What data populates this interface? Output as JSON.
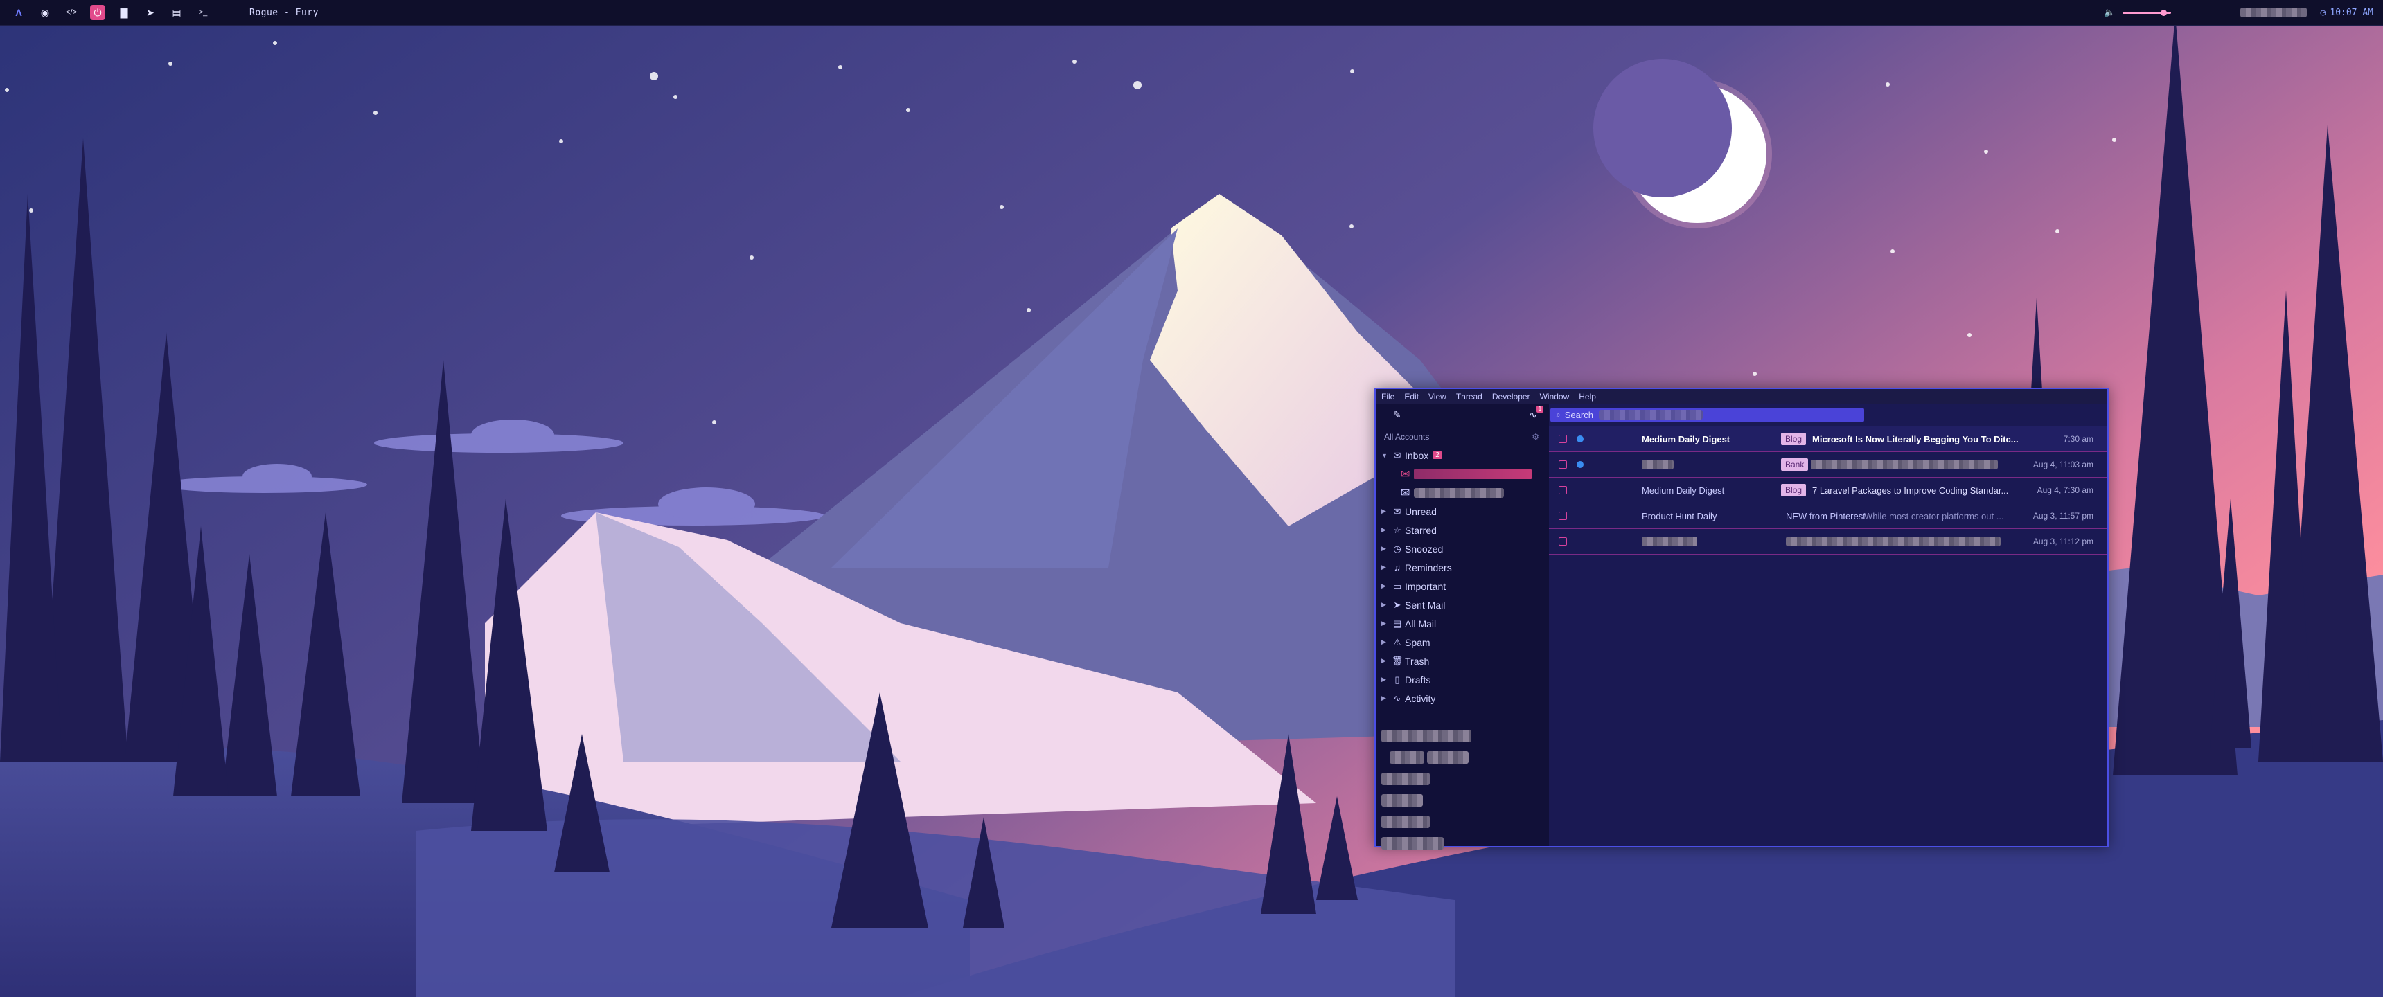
{
  "wallpaper": {
    "sky_top": "#2b2f74",
    "sky_bottom": "#ff8aa0",
    "moon_color": "#ffffff",
    "snow_color": "#fff4d4",
    "tree_color": "#1e1b4e"
  },
  "topbar": {
    "launcher_icon": "arch-logo-icon",
    "apps": [
      {
        "name": "chrome-icon",
        "glyph": "◉"
      },
      {
        "name": "code-icon",
        "glyph": "</>"
      },
      {
        "name": "terminal-active-icon",
        "glyph": "⏻"
      },
      {
        "name": "folder-icon",
        "glyph": "▇"
      },
      {
        "name": "telegram-icon",
        "glyph": "➤"
      },
      {
        "name": "notes-icon",
        "glyph": "▤"
      },
      {
        "name": "shell-icon",
        "glyph": ">_"
      }
    ],
    "window_title": "Rogue - Fury",
    "volume_icon": "🔈",
    "volume_level": 0.85,
    "clock_icon": "◷",
    "clock": "10:07 AM"
  },
  "mail": {
    "menu": [
      "File",
      "Edit",
      "View",
      "Thread",
      "Developer",
      "Window",
      "Help"
    ],
    "compose_icon": "✎",
    "activity_badge": "1",
    "search_placeholder": "Search",
    "sidebar": {
      "section": "All Accounts",
      "inbox_label": "Inbox",
      "inbox_badge": "2",
      "folders": [
        {
          "label": "Unread",
          "icon": "✉"
        },
        {
          "label": "Starred",
          "icon": "☆"
        },
        {
          "label": "Snoozed",
          "icon": "◷"
        },
        {
          "label": "Reminders",
          "icon": "♫"
        },
        {
          "label": "Important",
          "icon": "▭"
        },
        {
          "label": "Sent Mail",
          "icon": "➤"
        },
        {
          "label": "All Mail",
          "icon": "▤"
        },
        {
          "label": "Spam",
          "icon": "⚠"
        },
        {
          "label": "Trash",
          "icon": "🗑"
        },
        {
          "label": "Drafts",
          "icon": "▯"
        },
        {
          "label": "Activity",
          "icon": "∿"
        }
      ]
    },
    "messages": [
      {
        "sender": "Medium Daily Digest",
        "label": "Blog",
        "subject": "Microsoft Is Now Literally Begging You To Ditc...",
        "date": "7:30 am",
        "unread": true
      },
      {
        "sender": "",
        "label": "Bank",
        "subject": "",
        "date": "Aug 4, 11:03 am",
        "unread": true
      },
      {
        "sender": "Medium Daily Digest",
        "label": "Blog",
        "subject": "7 Laravel Packages to Improve Coding Standar...",
        "date": "Aug 4, 7:30 am",
        "unread": false
      },
      {
        "sender": "Product Hunt Daily",
        "label": "",
        "subject": "NEW from Pinterest",
        "snippet": "While most creator platforms out ...",
        "date": "Aug 3, 11:57 pm",
        "unread": false
      },
      {
        "sender": "",
        "label": "",
        "subject": "",
        "date": "Aug 3, 11:12 pm",
        "unread": false
      }
    ]
  }
}
